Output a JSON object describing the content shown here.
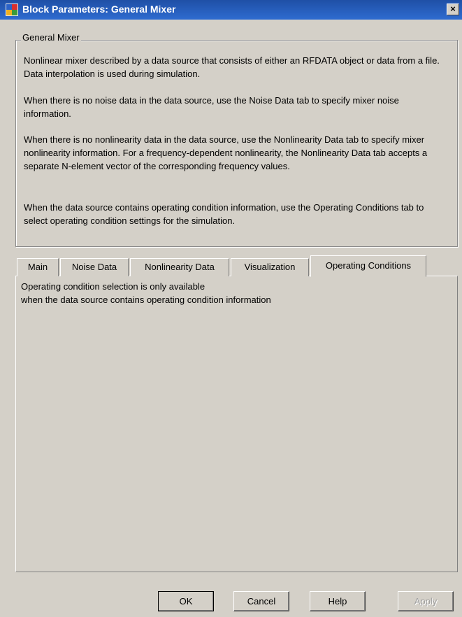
{
  "window": {
    "title": "Block Parameters: General Mixer",
    "close_glyph": "×"
  },
  "group": {
    "legend": "General Mixer",
    "paragraphs": [
      "Nonlinear mixer described by a data source that consists of either an RFDATA object or data from a file. Data interpolation is used during simulation.",
      "When there is no noise data in the data source, use the Noise Data tab to specify mixer noise information.",
      "When there is no nonlinearity data in the data source, use the Nonlinearity Data tab to specify mixer nonlinearity information. For a frequency-dependent nonlinearity, the Nonlinearity Data tab accepts a separate N-element vector of the corresponding frequency values.",
      "When the data source contains operating condition information, use the Operating Conditions tab to select operating condition settings for the simulation."
    ]
  },
  "tabs": [
    {
      "label": "Main"
    },
    {
      "label": "Noise Data"
    },
    {
      "label": "Nonlinearity Data"
    },
    {
      "label": "Visualization"
    },
    {
      "label": "Operating Conditions",
      "active": true
    }
  ],
  "panel": {
    "line1": "Operating condition selection is only available",
    "line2": "when the data source contains operating condition information"
  },
  "buttons": {
    "ok": "OK",
    "cancel": "Cancel",
    "help": "Help",
    "apply": "Apply"
  },
  "icons": {
    "title_icon": "simulink-block-icon",
    "close_icon": "close-icon"
  },
  "colors": {
    "titlebar": "#2e6bd0",
    "dialog_bg": "#d4d0c8"
  }
}
